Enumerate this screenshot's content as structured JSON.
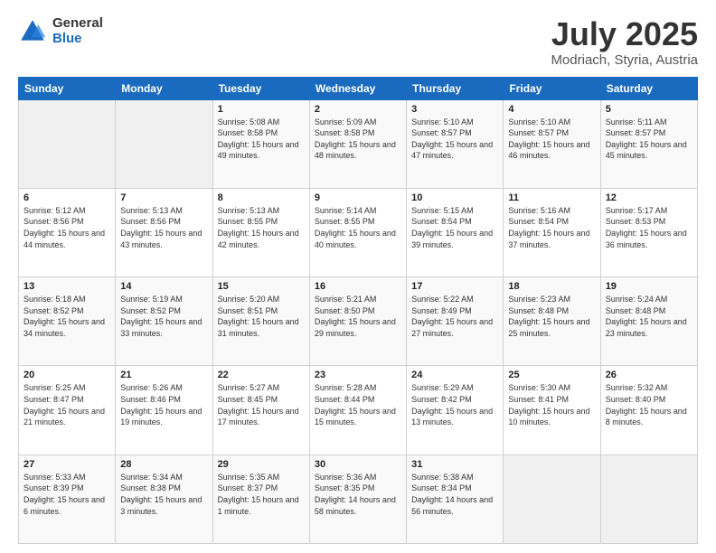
{
  "logo": {
    "general": "General",
    "blue": "Blue"
  },
  "header": {
    "title": "July 2025",
    "subtitle": "Modriach, Styria, Austria"
  },
  "weekdays": [
    "Sunday",
    "Monday",
    "Tuesday",
    "Wednesday",
    "Thursday",
    "Friday",
    "Saturday"
  ],
  "weeks": [
    [
      {
        "day": "",
        "empty": true
      },
      {
        "day": "",
        "empty": true
      },
      {
        "day": "1",
        "sunrise": "5:08 AM",
        "sunset": "8:58 PM",
        "daylight": "15 hours and 49 minutes."
      },
      {
        "day": "2",
        "sunrise": "5:09 AM",
        "sunset": "8:58 PM",
        "daylight": "15 hours and 48 minutes."
      },
      {
        "day": "3",
        "sunrise": "5:10 AM",
        "sunset": "8:57 PM",
        "daylight": "15 hours and 47 minutes."
      },
      {
        "day": "4",
        "sunrise": "5:10 AM",
        "sunset": "8:57 PM",
        "daylight": "15 hours and 46 minutes."
      },
      {
        "day": "5",
        "sunrise": "5:11 AM",
        "sunset": "8:57 PM",
        "daylight": "15 hours and 45 minutes."
      }
    ],
    [
      {
        "day": "6",
        "sunrise": "5:12 AM",
        "sunset": "8:56 PM",
        "daylight": "15 hours and 44 minutes."
      },
      {
        "day": "7",
        "sunrise": "5:13 AM",
        "sunset": "8:56 PM",
        "daylight": "15 hours and 43 minutes."
      },
      {
        "day": "8",
        "sunrise": "5:13 AM",
        "sunset": "8:55 PM",
        "daylight": "15 hours and 42 minutes."
      },
      {
        "day": "9",
        "sunrise": "5:14 AM",
        "sunset": "8:55 PM",
        "daylight": "15 hours and 40 minutes."
      },
      {
        "day": "10",
        "sunrise": "5:15 AM",
        "sunset": "8:54 PM",
        "daylight": "15 hours and 39 minutes."
      },
      {
        "day": "11",
        "sunrise": "5:16 AM",
        "sunset": "8:54 PM",
        "daylight": "15 hours and 37 minutes."
      },
      {
        "day": "12",
        "sunrise": "5:17 AM",
        "sunset": "8:53 PM",
        "daylight": "15 hours and 36 minutes."
      }
    ],
    [
      {
        "day": "13",
        "sunrise": "5:18 AM",
        "sunset": "8:52 PM",
        "daylight": "15 hours and 34 minutes."
      },
      {
        "day": "14",
        "sunrise": "5:19 AM",
        "sunset": "8:52 PM",
        "daylight": "15 hours and 33 minutes."
      },
      {
        "day": "15",
        "sunrise": "5:20 AM",
        "sunset": "8:51 PM",
        "daylight": "15 hours and 31 minutes."
      },
      {
        "day": "16",
        "sunrise": "5:21 AM",
        "sunset": "8:50 PM",
        "daylight": "15 hours and 29 minutes."
      },
      {
        "day": "17",
        "sunrise": "5:22 AM",
        "sunset": "8:49 PM",
        "daylight": "15 hours and 27 minutes."
      },
      {
        "day": "18",
        "sunrise": "5:23 AM",
        "sunset": "8:48 PM",
        "daylight": "15 hours and 25 minutes."
      },
      {
        "day": "19",
        "sunrise": "5:24 AM",
        "sunset": "8:48 PM",
        "daylight": "15 hours and 23 minutes."
      }
    ],
    [
      {
        "day": "20",
        "sunrise": "5:25 AM",
        "sunset": "8:47 PM",
        "daylight": "15 hours and 21 minutes."
      },
      {
        "day": "21",
        "sunrise": "5:26 AM",
        "sunset": "8:46 PM",
        "daylight": "15 hours and 19 minutes."
      },
      {
        "day": "22",
        "sunrise": "5:27 AM",
        "sunset": "8:45 PM",
        "daylight": "15 hours and 17 minutes."
      },
      {
        "day": "23",
        "sunrise": "5:28 AM",
        "sunset": "8:44 PM",
        "daylight": "15 hours and 15 minutes."
      },
      {
        "day": "24",
        "sunrise": "5:29 AM",
        "sunset": "8:42 PM",
        "daylight": "15 hours and 13 minutes."
      },
      {
        "day": "25",
        "sunrise": "5:30 AM",
        "sunset": "8:41 PM",
        "daylight": "15 hours and 10 minutes."
      },
      {
        "day": "26",
        "sunrise": "5:32 AM",
        "sunset": "8:40 PM",
        "daylight": "15 hours and 8 minutes."
      }
    ],
    [
      {
        "day": "27",
        "sunrise": "5:33 AM",
        "sunset": "8:39 PM",
        "daylight": "15 hours and 6 minutes."
      },
      {
        "day": "28",
        "sunrise": "5:34 AM",
        "sunset": "8:38 PM",
        "daylight": "15 hours and 3 minutes."
      },
      {
        "day": "29",
        "sunrise": "5:35 AM",
        "sunset": "8:37 PM",
        "daylight": "15 hours and 1 minute."
      },
      {
        "day": "30",
        "sunrise": "5:36 AM",
        "sunset": "8:35 PM",
        "daylight": "14 hours and 58 minutes."
      },
      {
        "day": "31",
        "sunrise": "5:38 AM",
        "sunset": "8:34 PM",
        "daylight": "14 hours and 56 minutes."
      },
      {
        "day": "",
        "empty": true
      },
      {
        "day": "",
        "empty": true
      }
    ]
  ]
}
